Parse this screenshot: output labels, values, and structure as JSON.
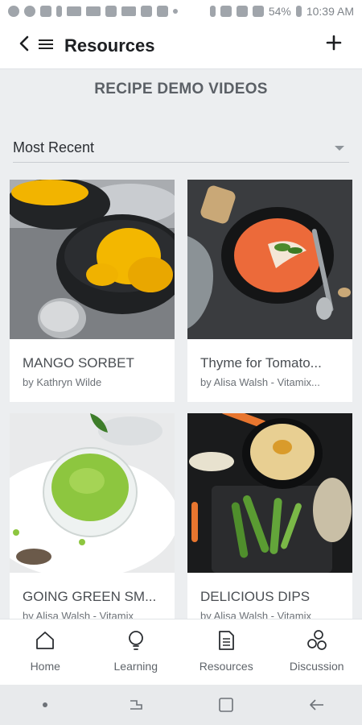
{
  "status_bar": {
    "battery": "54%",
    "time": "10:39 AM"
  },
  "app_bar": {
    "title": "Resources",
    "icons": [
      "back-arrow-icon",
      "hamburger-menu-icon",
      "plus-icon"
    ]
  },
  "section": {
    "title": "RECIPE DEMO VIDEOS"
  },
  "sort": {
    "selected": "Most Recent"
  },
  "cards": [
    {
      "title": "MANGO SORBET",
      "author": "by Kathryn Wilde"
    },
    {
      "title": "Thyme for Tomato...",
      "author": "by Alisa Walsh - Vitamix..."
    },
    {
      "title": "GOING GREEN SM...",
      "author": "by Alisa Walsh - Vitamix"
    },
    {
      "title": "DELICIOUS DIPS",
      "author": "by Alisa Walsh - Vitamix"
    }
  ],
  "bottom_nav": {
    "tabs": [
      {
        "label": "Home",
        "icon": "home-icon"
      },
      {
        "label": "Learning",
        "icon": "lightbulb-icon"
      },
      {
        "label": "Resources",
        "icon": "document-icon"
      },
      {
        "label": "Discussion",
        "icon": "discussion-bubbles-icon"
      }
    ]
  },
  "colors": {
    "background": "#eceef0",
    "card": "#ffffff",
    "title_text": "#1d1f22"
  }
}
